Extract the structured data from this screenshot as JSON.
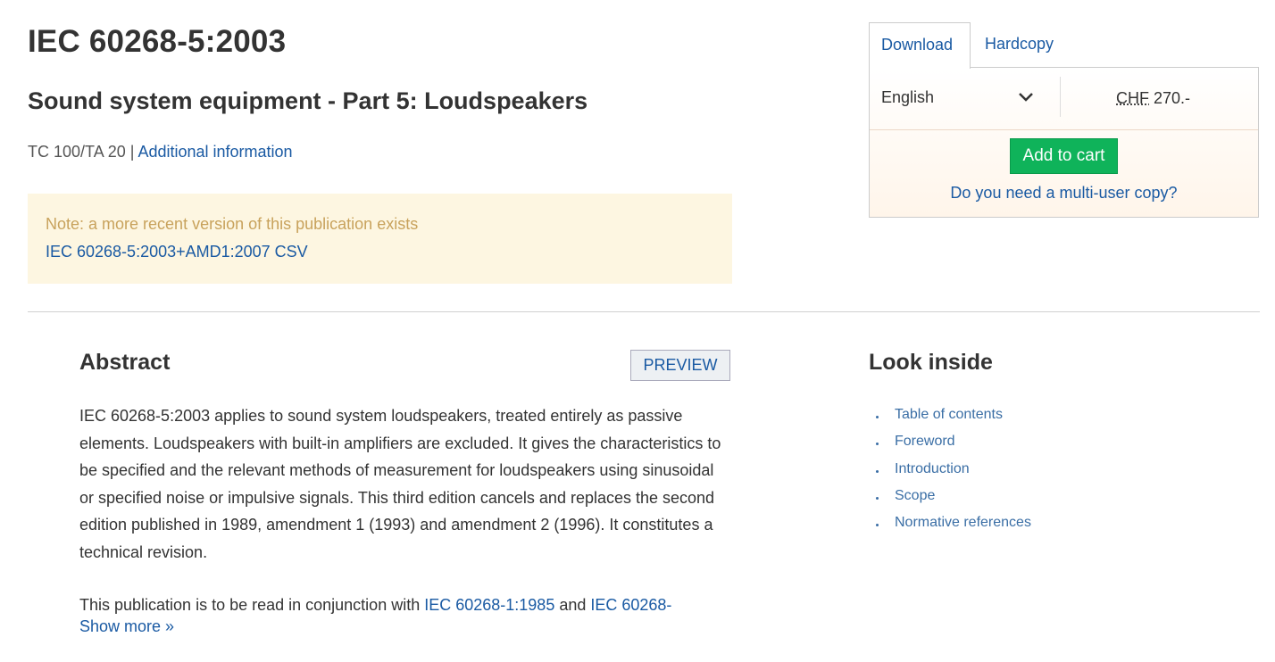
{
  "header": {
    "title": "IEC 60268-5:2003",
    "subtitle": "Sound system equipment - Part 5: Loudspeakers",
    "committee": "TC 100/TA 20",
    "separator": "|",
    "additional_info_link": "Additional information"
  },
  "note": {
    "text": "Note: a more recent version of this publication exists",
    "link": "IEC 60268-5:2003+AMD1:2007 CSV"
  },
  "purchase": {
    "tabs": [
      {
        "label": "Download",
        "active": true
      },
      {
        "label": "Hardcopy",
        "active": false
      }
    ],
    "language": "English",
    "currency": "CHF",
    "price": "270.-",
    "add_to_cart": "Add to cart",
    "multi_user": "Do you need a multi-user copy?",
    "colors": {
      "add_to_cart_bg": "#0fb35a",
      "link": "#1a5aa3"
    }
  },
  "abstract": {
    "heading": "Abstract",
    "preview_button": "PREVIEW",
    "paragraph": "IEC 60268-5:2003 applies to sound system loudspeakers, treated entirely as passive elements. Loudspeakers with built-in amplifiers are excluded. It gives the characteristics to be specified and the relevant methods of measurement for loudspeakers using sinusoidal or specified noise or impulsive signals. This third edition cancels and replaces the second edition published in 1989, amendment 1 (1993) and amendment 2 (1996). It constitutes a technical revision.",
    "paragraph2_prefix": "This publication is to be read in conjunction with ",
    "paragraph2_link1": "IEC 60268-1:1985",
    "paragraph2_mid": " and ",
    "paragraph2_link2": "IEC 60268-",
    "show_more": "Show more »"
  },
  "look_inside": {
    "heading": "Look inside",
    "items": [
      "Table of contents",
      "Foreword",
      "Introduction",
      "Scope",
      "Normative references"
    ]
  }
}
